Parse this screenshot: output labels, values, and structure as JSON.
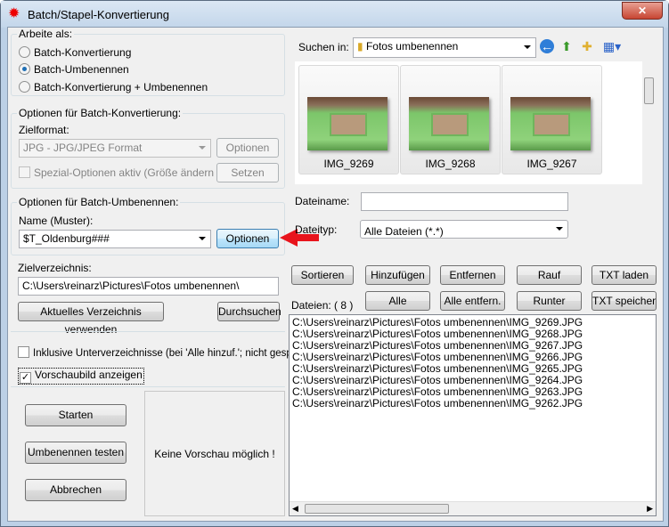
{
  "window": {
    "title": "Batch/Stapel-Konvertierung",
    "close": "✕"
  },
  "mode": {
    "legend": "Arbeite als:",
    "options": [
      "Batch-Konvertierung",
      "Batch-Umbenennen",
      "Batch-Konvertierung + Umbenennen"
    ],
    "selected": 1
  },
  "convert": {
    "legend": "Optionen für Batch-Konvertierung:",
    "format_label": "Zielformat:",
    "format_value": "JPG - JPG/JPEG Format",
    "options_btn": "Optionen",
    "special_label": "Spezial-Optionen aktiv (Größe ändern etc.)",
    "set_btn": "Setzen"
  },
  "rename": {
    "legend": "Optionen für Batch-Umbenennen:",
    "pattern_label": "Name (Muster):",
    "pattern_value": "$T_Oldenburg###",
    "options_btn": "Optionen"
  },
  "target": {
    "legend": "Zielverzeichnis:",
    "path": "C:\\Users\\reinarz\\Pictures\\Fotos umbenennen\\",
    "use_current_btn": "Aktuelles Verzeichnis verwenden",
    "browse_btn": "Durchsuchen"
  },
  "flags": {
    "subdirs": "Inklusive Unterverzeichnisse (bei 'Alle hinzuf.'; nicht gesp.)",
    "subdirs_checked": false,
    "preview": "Vorschaubild anzeigen",
    "preview_checked": true
  },
  "actions": {
    "start": "Starten",
    "test": "Umbenennen testen",
    "cancel": "Abbrechen",
    "no_preview": "Keine Vorschau möglich !"
  },
  "browser": {
    "look_in_label": "Suchen in:",
    "look_in_value": "Fotos umbenennen",
    "thumbnails": [
      "IMG_9269",
      "IMG_9268",
      "IMG_9267"
    ],
    "filename_label": "Dateiname:",
    "filename_value": "",
    "filetype_label": "Dateityp:",
    "filetype_value": "Alle Dateien (*.*)"
  },
  "list": {
    "buttons_row1": [
      "Sortieren",
      "Hinzufügen",
      "Entfernen",
      "Rauf",
      "TXT laden"
    ],
    "buttons_row2": [
      "Alle hinzufüg.",
      "Alle entfern.",
      "Runter",
      "TXT speichern"
    ],
    "count_label": "Dateien:  ( 8 )",
    "files": [
      "C:\\Users\\reinarz\\Pictures\\Fotos umbenennen\\IMG_9269.JPG",
      "C:\\Users\\reinarz\\Pictures\\Fotos umbenennen\\IMG_9268.JPG",
      "C:\\Users\\reinarz\\Pictures\\Fotos umbenennen\\IMG_9267.JPG",
      "C:\\Users\\reinarz\\Pictures\\Fotos umbenennen\\IMG_9266.JPG",
      "C:\\Users\\reinarz\\Pictures\\Fotos umbenennen\\IMG_9265.JPG",
      "C:\\Users\\reinarz\\Pictures\\Fotos umbenennen\\IMG_9264.JPG",
      "C:\\Users\\reinarz\\Pictures\\Fotos umbenennen\\IMG_9263.JPG",
      "C:\\Users\\reinarz\\Pictures\\Fotos umbenennen\\IMG_9262.JPG"
    ]
  }
}
